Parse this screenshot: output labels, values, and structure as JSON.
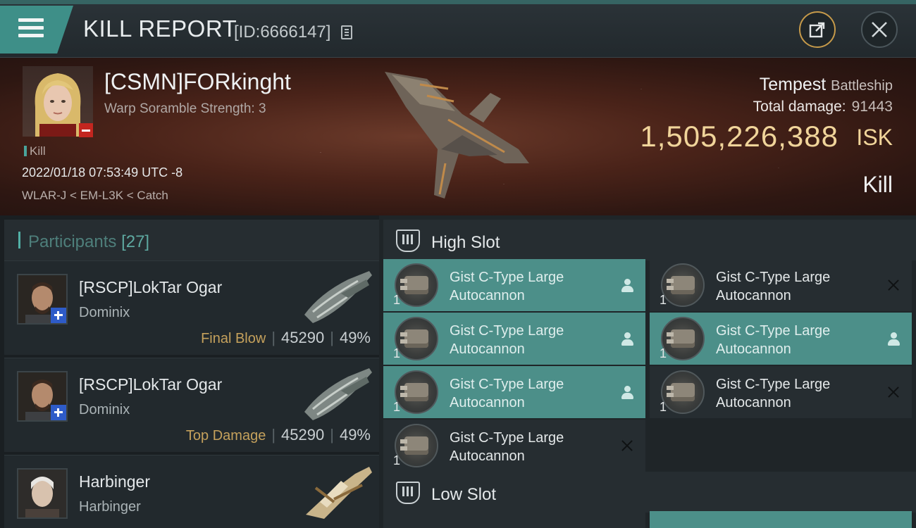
{
  "header": {
    "title": "KILL REPORT",
    "report_id": "[ID:6666147]",
    "menu_icon": "hamburger-menu-icon",
    "share_icon": "share-export-icon",
    "close_icon": "close-icon"
  },
  "victim": {
    "name": "[CSMN]FORkinght",
    "scramble": "Warp Soramble Strength: 3",
    "kill_tag": "Kill",
    "timestamp": "2022/01/18 07:53:49 UTC -8",
    "route": "WLAR-J < EM-L3K < Catch",
    "ship_name": "Tempest",
    "ship_class": "Battleship",
    "total_damage_label": "Total damage:",
    "total_damage": "91443",
    "isk_value": "1,505,226,388",
    "isk_unit": "ISK",
    "result": "Kill"
  },
  "participants": {
    "title": "Participants",
    "count": "[27]",
    "rows": [
      {
        "name": "[RSCP]LokTar Ogar",
        "ship": "Dominix",
        "tag": "Final Blow",
        "damage": "45290",
        "percent": "49%"
      },
      {
        "name": "[RSCP]LokTar Ogar",
        "ship": "Dominix",
        "tag": "Top Damage",
        "damage": "45290",
        "percent": "49%"
      },
      {
        "name": "Harbinger",
        "ship": "Harbinger"
      }
    ]
  },
  "slots": {
    "high_title": "High Slot",
    "low_title": "Low Slot",
    "high_modules": [
      {
        "line1": "Gist C-Type Large",
        "line2": "Autocannon",
        "qty": "1",
        "status": "dropped"
      },
      {
        "line1": "Gist C-Type Large",
        "line2": "Autocannon",
        "qty": "1",
        "status": "destroyed"
      },
      {
        "line1": "Gist C-Type Large",
        "line2": "Autocannon",
        "qty": "1",
        "status": "dropped"
      },
      {
        "line1": "Gist C-Type Large",
        "line2": "Autocannon",
        "qty": "1",
        "status": "dropped"
      },
      {
        "line1": "Gist C-Type Large",
        "line2": "Autocannon",
        "qty": "1",
        "status": "dropped"
      },
      {
        "line1": "Gist C-Type Large",
        "line2": "Autocannon",
        "qty": "1",
        "status": "destroyed"
      },
      {
        "line1": "Gist C-Type Large",
        "line2": "Autocannon",
        "qty": "1",
        "status": "destroyed"
      }
    ]
  },
  "colors": {
    "accent_teal": "#4c8f89",
    "isk_gold": "#f0d49a",
    "tag_gold": "#c5a15c"
  }
}
